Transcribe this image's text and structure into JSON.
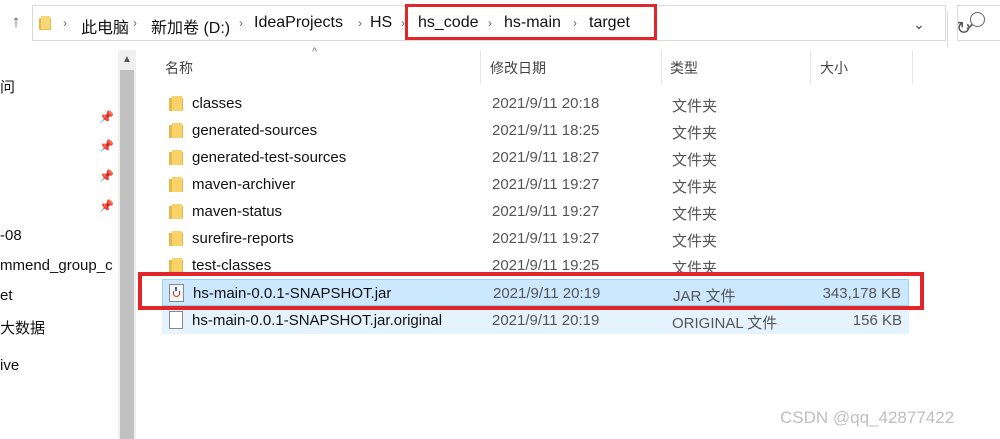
{
  "breadcrumbs": [
    {
      "label": "此电脑"
    },
    {
      "label": "新加卷 (D:)"
    },
    {
      "label": "IdeaProjects"
    },
    {
      "label": "HS"
    },
    {
      "label": "hs_code"
    },
    {
      "label": "hs-main"
    },
    {
      "label": "target"
    }
  ],
  "columns": {
    "name": "名称",
    "date": "修改日期",
    "type": "类型",
    "size": "大小"
  },
  "nav": {
    "items": [
      {
        "label": "问"
      },
      {
        "label": "-08"
      },
      {
        "label": "mmend_group_c"
      },
      {
        "label": "et"
      },
      {
        "label": "大数据"
      },
      {
        "label": "ive"
      }
    ]
  },
  "files": [
    {
      "name": "classes",
      "date": "2021/9/11 20:18",
      "type": "文件夹",
      "size": "",
      "icon": "folder-icon"
    },
    {
      "name": "generated-sources",
      "date": "2021/9/11 18:25",
      "type": "文件夹",
      "size": "",
      "icon": "folder-icon"
    },
    {
      "name": "generated-test-sources",
      "date": "2021/9/11 18:27",
      "type": "文件夹",
      "size": "",
      "icon": "folder-icon"
    },
    {
      "name": "maven-archiver",
      "date": "2021/9/11 19:27",
      "type": "文件夹",
      "size": "",
      "icon": "folder-icon"
    },
    {
      "name": "maven-status",
      "date": "2021/9/11 19:27",
      "type": "文件夹",
      "size": "",
      "icon": "folder-icon"
    },
    {
      "name": "surefire-reports",
      "date": "2021/9/11 19:27",
      "type": "文件夹",
      "size": "",
      "icon": "folder-icon"
    },
    {
      "name": "test-classes",
      "date": "2021/9/11 19:25",
      "type": "文件夹",
      "size": "",
      "icon": "folder-icon"
    },
    {
      "name": "hs-main-0.0.1-SNAPSHOT.jar",
      "date": "2021/9/11 20:19",
      "type": "JAR 文件",
      "size": "343,178 KB",
      "icon": "jar-file-icon"
    },
    {
      "name": "hs-main-0.0.1-SNAPSHOT.jar.original",
      "date": "2021/9/11 20:19",
      "type": "ORIGINAL 文件",
      "size": "156 KB",
      "icon": "document-icon"
    }
  ],
  "watermark": "CSDN @qq_42877422",
  "colors": {
    "highlight_box": "#e0262a",
    "selected_row": "#cce8ff",
    "folder": "#f9d36a"
  }
}
